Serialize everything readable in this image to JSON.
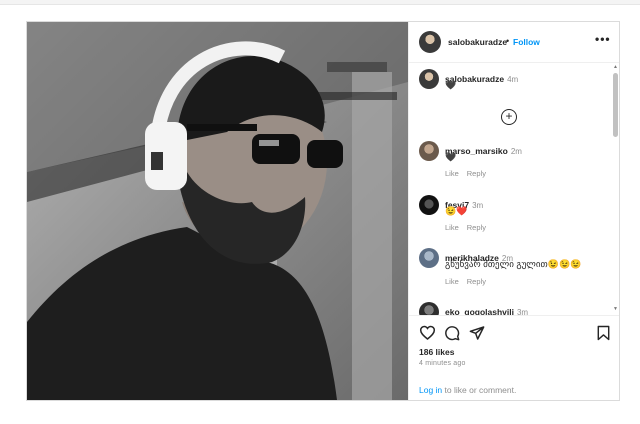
{
  "post": {
    "author": "salobakuradze",
    "separator": "•",
    "follow_label": "Follow",
    "more_label": "•••",
    "caption": {
      "user": "salobakuradze",
      "time": "4m",
      "text": "🖤"
    },
    "load_more_label": "+",
    "comments": [
      {
        "user": "marso_marsiko",
        "time": "2m",
        "text": "🖤",
        "like": "Like",
        "reply": "Reply"
      },
      {
        "user": "fesvi7",
        "time": "3m",
        "text": "😉❤️",
        "like": "Like",
        "reply": "Reply"
      },
      {
        "user": "merikhaladze",
        "time": "2m",
        "text": "გწუნვარ მთელი გულით😉😉😉",
        "like": "Like",
        "reply": "Reply"
      },
      {
        "user": "eko_gogolashvili",
        "time": "3m",
        "text": ""
      }
    ],
    "likes": "186 likes",
    "posted_ago": "4 minutes ago",
    "login_link": "Log in",
    "login_suffix": " to like or comment.",
    "icons": [
      "heart-icon",
      "comment-icon",
      "share-icon",
      "bookmark-icon"
    ],
    "accent_color": "#0095f6"
  }
}
